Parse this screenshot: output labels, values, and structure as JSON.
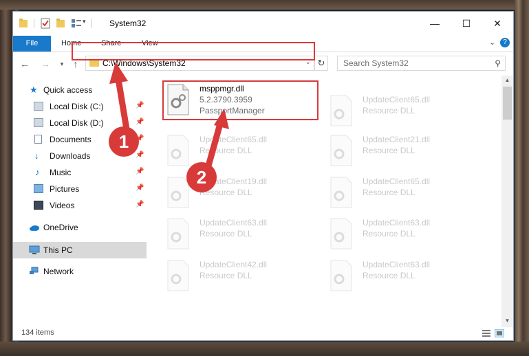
{
  "window": {
    "title": "System32",
    "controls": {
      "minimize": "—",
      "maximize": "☐",
      "close": "✕"
    }
  },
  "ribbon": {
    "tabs": [
      "File",
      "Home",
      "Share",
      "View"
    ],
    "help": "?"
  },
  "address": {
    "path": "C:\\Windows\\System32",
    "search_placeholder": "Search System32"
  },
  "navpane": {
    "items": [
      {
        "label": "Quick access",
        "icon": "star-icon",
        "pinned": false
      },
      {
        "label": "Local Disk (C:)",
        "icon": "drive-icon",
        "pinned": true
      },
      {
        "label": "Local Disk (D:)",
        "icon": "drive-icon",
        "pinned": true
      },
      {
        "label": "Documents",
        "icon": "documents-icon",
        "pinned": true
      },
      {
        "label": "Downloads",
        "icon": "download-icon",
        "pinned": true
      },
      {
        "label": "Music",
        "icon": "music-icon",
        "pinned": true
      },
      {
        "label": "Pictures",
        "icon": "pictures-icon",
        "pinned": true
      },
      {
        "label": "Videos",
        "icon": "videos-icon",
        "pinned": true
      },
      {
        "label": "OneDrive",
        "icon": "cloud-icon",
        "pinned": false
      },
      {
        "label": "This PC",
        "icon": "computer-icon",
        "pinned": false
      },
      {
        "label": "Network",
        "icon": "network-icon",
        "pinned": false
      }
    ]
  },
  "files": {
    "selected": {
      "name": "msppmgr.dll",
      "version": "5.2.3790.3959",
      "description": "PassportManager"
    },
    "others": [
      {
        "name": "UpdateClient65.dll",
        "description": "Resource DLL"
      },
      {
        "name": "UpdateClient65.dll",
        "description": "Resource DLL"
      },
      {
        "name": "UpdateClient21.dll",
        "description": "Resource DLL"
      },
      {
        "name": "UpdateClient19.dll",
        "description": "Resource DLL"
      },
      {
        "name": "UpdateClient65.dll",
        "description": "Resource DLL"
      },
      {
        "name": "UpdateClient63.dll",
        "description": "Resource DLL"
      },
      {
        "name": "UpdateClient63.dll",
        "description": "Resource DLL"
      },
      {
        "name": "UpdateClient42.dll",
        "description": "Resource DLL"
      },
      {
        "name": "UpdateClient63.dll",
        "description": "Resource DLL"
      }
    ]
  },
  "status": {
    "count": "134 items"
  },
  "annotations": {
    "step1": "1",
    "step2": "2"
  },
  "colors": {
    "accent": "#1979ca",
    "highlight": "#d83a3a",
    "selection": "#cce8ff",
    "folder": "#f0c95c"
  }
}
